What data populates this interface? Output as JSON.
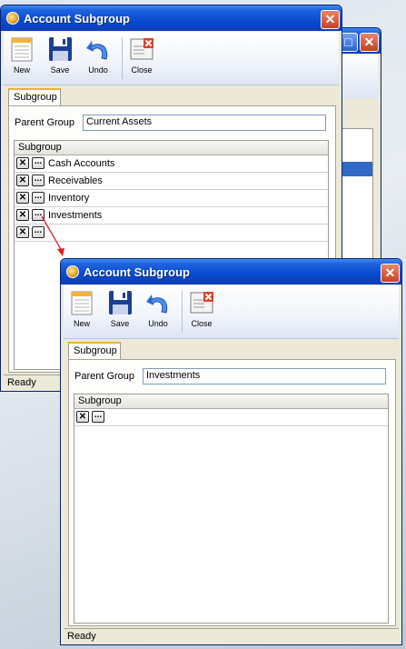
{
  "back_window": {
    "title": "Account Subgroup",
    "toolbar": {
      "new": "New",
      "save": "Save",
      "undo": "Undo",
      "close": "Close"
    },
    "tab": "Subgroup",
    "parent_label": "Parent Group",
    "parent_value": "Current Assets",
    "grid_header": "Subgroup",
    "rows": [
      "Cash Accounts",
      "Receivables",
      "Inventory",
      "Investments",
      ""
    ],
    "status": "Ready"
  },
  "front_window": {
    "title": "Account Subgroup",
    "toolbar": {
      "new": "New",
      "save": "Save",
      "undo": "Undo",
      "close": "Close"
    },
    "tab": "Subgroup",
    "parent_label": "Parent Group",
    "parent_value": "Investments",
    "grid_header": "Subgroup",
    "rows": [
      ""
    ],
    "status": "Ready"
  },
  "icons": {
    "row_delete": "close-x-icon",
    "row_open": "ellipsis-icon",
    "new": "new-document-icon",
    "save": "floppy-disk-icon",
    "undo": "undo-arrow-icon",
    "close": "close-document-icon"
  },
  "colors": {
    "title_bar": "#0a4ad0",
    "close_button": "#c44321",
    "tab_accent": "#f0b03c",
    "arrow": "#e02020"
  }
}
